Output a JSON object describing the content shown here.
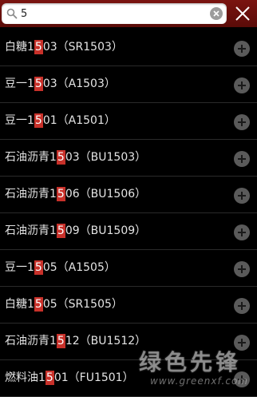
{
  "search": {
    "value": "5"
  },
  "results": [
    {
      "prefix": "白糖1",
      "match": "5",
      "suffix": "03（SR1503）"
    },
    {
      "prefix": "豆一1",
      "match": "5",
      "suffix": "03（A1503）"
    },
    {
      "prefix": "豆一1",
      "match": "5",
      "suffix": "01（A1501）"
    },
    {
      "prefix": "石油沥青1",
      "match": "5",
      "suffix": "03（BU1503）"
    },
    {
      "prefix": "石油沥青1",
      "match": "5",
      "suffix": "06（BU1506）"
    },
    {
      "prefix": "石油沥青1",
      "match": "5",
      "suffix": "09（BU1509）"
    },
    {
      "prefix": "豆一1",
      "match": "5",
      "suffix": "05（A1505）"
    },
    {
      "prefix": "白糖1",
      "match": "5",
      "suffix": "05（SR1505）"
    },
    {
      "prefix": "石油沥青1",
      "match": "5",
      "suffix": "12（BU1512）"
    },
    {
      "prefix": "燃料油1",
      "match": "5",
      "suffix": "01（FU1501）"
    }
  ],
  "watermark": {
    "logo_text": "绿色先锋",
    "url": "www.greenxf.com"
  },
  "colors": {
    "topbar": "#6b100c",
    "highlight": "#c8312a",
    "background": "#000000"
  }
}
